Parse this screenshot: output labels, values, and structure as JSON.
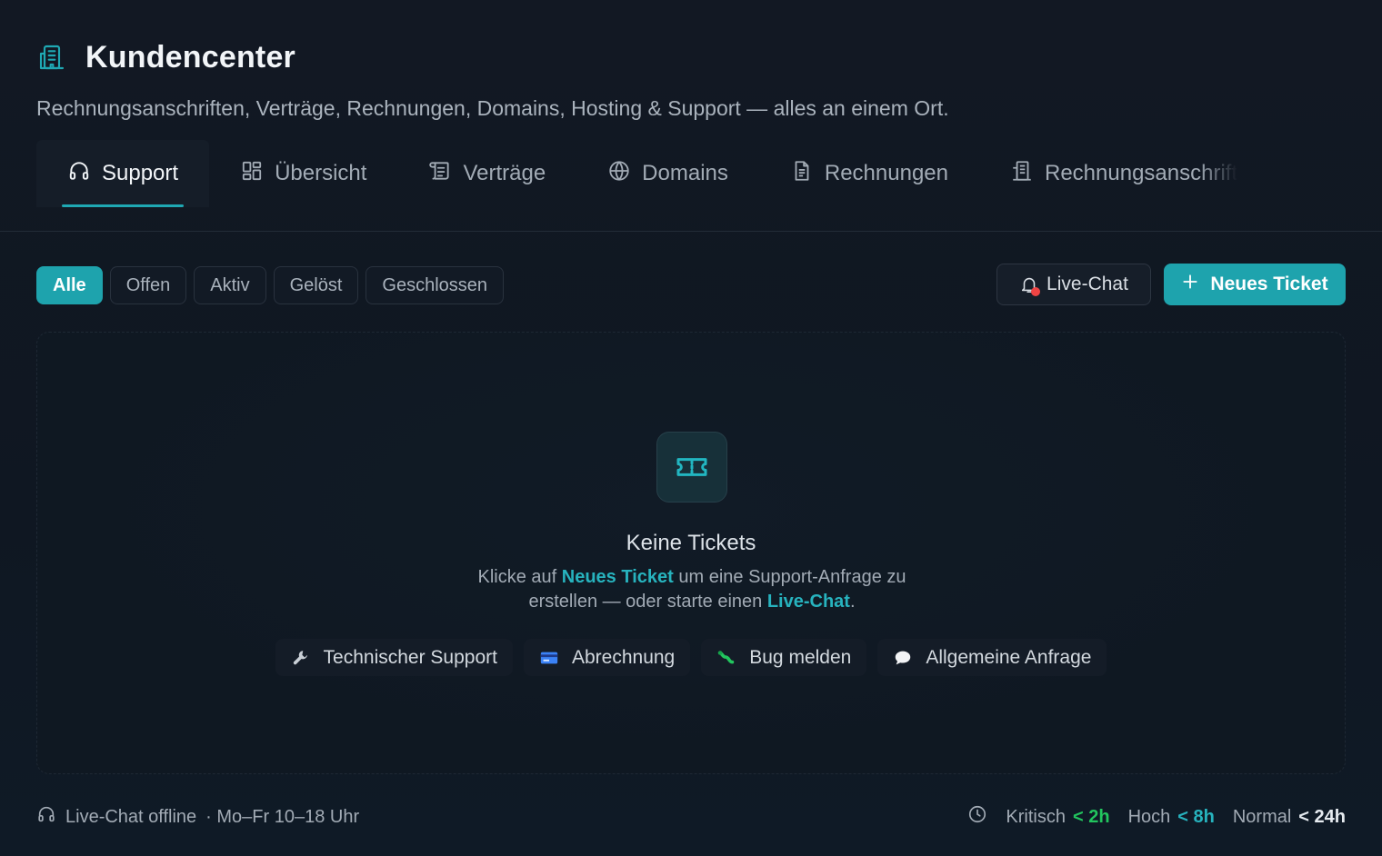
{
  "header": {
    "title": "Kundencenter",
    "subtitle": "Rechnungsanschriften, Verträge, Rechnungen, Domains, Hosting & Support — alles an einem Ort.",
    "icon": "building-icon"
  },
  "tabs": [
    {
      "label": "Support",
      "icon": "headset-icon",
      "active": true
    },
    {
      "label": "Übersicht",
      "icon": "grid-icon"
    },
    {
      "label": "Verträge",
      "icon": "scroll-icon"
    },
    {
      "label": "Domains",
      "icon": "globe-icon"
    },
    {
      "label": "Rechnungen",
      "icon": "document-icon"
    },
    {
      "label": "Rechnungsanschrift",
      "icon": "building-icon"
    }
  ],
  "filters": [
    {
      "label": "Alle",
      "active": true
    },
    {
      "label": "Offen"
    },
    {
      "label": "Aktiv"
    },
    {
      "label": "Gelöst"
    },
    {
      "label": "Geschlossen"
    }
  ],
  "actions": {
    "live_chat": "Live-Chat",
    "new_ticket": "Neues Ticket"
  },
  "empty_state": {
    "title": "Keine Tickets",
    "text_1": "Klicke auf ",
    "link_1": "Neues Ticket",
    "text_2": " um eine Support-Anfrage zu erstellen — oder starte einen ",
    "link_2": "Live-Chat",
    "text_3": ".",
    "categories": [
      {
        "label": "Technischer Support",
        "icon": "wrench-icon"
      },
      {
        "label": "Abrechnung",
        "icon": "credit-card-icon"
      },
      {
        "label": "Bug melden",
        "icon": "bug-icon"
      },
      {
        "label": "Allgemeine Anfrage",
        "icon": "speech-bubble-icon"
      }
    ]
  },
  "footer": {
    "chat_status": "Live-Chat offline",
    "hours": "· Mo–Fr 10–18 Uhr",
    "sla": [
      {
        "label": "Kritisch",
        "value": "< 2h",
        "color": "#22c55e"
      },
      {
        "label": "Hoch",
        "value": "< 8h",
        "color": "#27b3be"
      },
      {
        "label": "Normal",
        "value": "< 24h",
        "color": "#e6ebf0"
      }
    ]
  },
  "colors": {
    "accent": "#1ea3ad",
    "background": "#121823",
    "alert_dot": "#ef4444"
  }
}
